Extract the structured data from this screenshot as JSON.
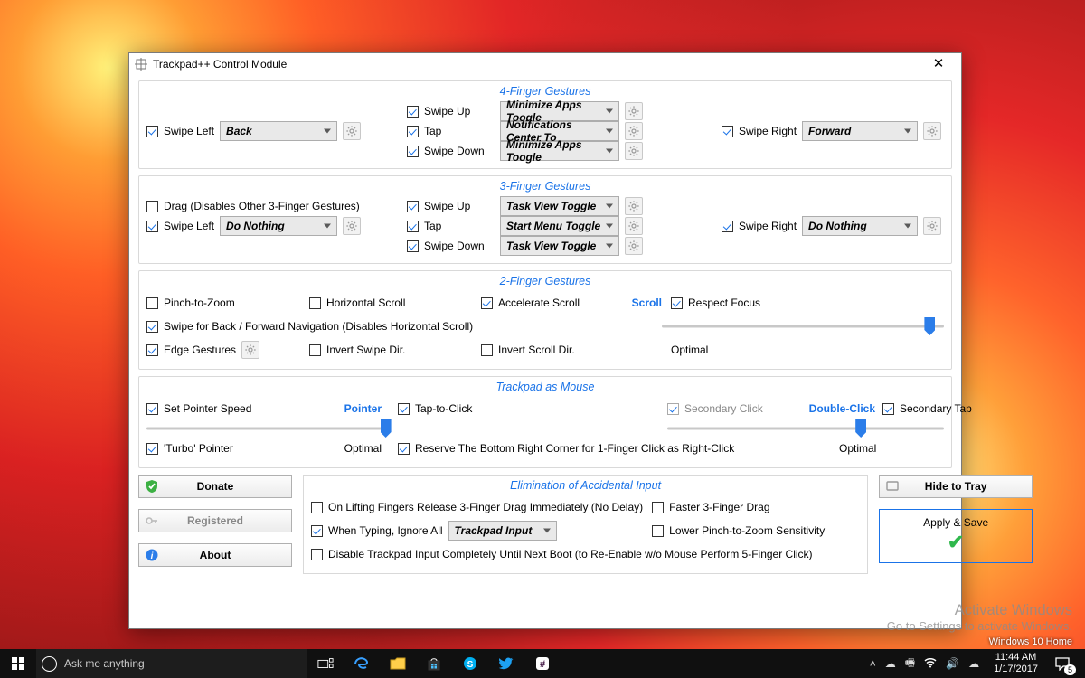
{
  "window": {
    "title": "Trackpad++ Control Module"
  },
  "g4": {
    "title": "4-Finger Gestures",
    "swipe_up": {
      "label": "Swipe Up",
      "value": "Minimize Apps Toogle"
    },
    "tap": {
      "label": "Tap",
      "value": "Notifications Center To"
    },
    "swipe_down": {
      "label": "Swipe Down",
      "value": "Minimize Apps Toogle"
    },
    "swipe_left": {
      "label": "Swipe Left",
      "value": "Back"
    },
    "swipe_right": {
      "label": "Swipe Right",
      "value": "Forward"
    }
  },
  "g3": {
    "title": "3-Finger Gestures",
    "drag": {
      "label": "Drag (Disables Other 3-Finger Gestures)"
    },
    "swipe_up": {
      "label": "Swipe Up",
      "value": "Task View Toggle"
    },
    "tap": {
      "label": "Tap",
      "value": "Start Menu Toggle"
    },
    "swipe_down": {
      "label": "Swipe Down",
      "value": "Task View Toggle"
    },
    "swipe_left": {
      "label": "Swipe Left",
      "value": "Do Nothing"
    },
    "swipe_right": {
      "label": "Swipe Right",
      "value": "Do Nothing"
    }
  },
  "g2": {
    "title": "2-Finger Gestures",
    "pinch": "Pinch-to-Zoom",
    "hscroll": "Horizontal Scroll",
    "accel": "Accelerate Scroll",
    "scroll_link": "Scroll",
    "respect": "Respect Focus",
    "swipe_nav": "Swipe for Back / Forward Navigation (Disables Horizontal Scroll)",
    "edge": "Edge Gestures",
    "invert_swipe": "Invert Swipe Dir.",
    "invert_scroll": "Invert Scroll Dir.",
    "optimal": "Optimal"
  },
  "mouse": {
    "title": "Trackpad as Mouse",
    "set_speed": "Set Pointer Speed",
    "pointer_link": "Pointer",
    "tap_click": "Tap-to-Click",
    "secondary_click": "Secondary Click",
    "double_link": "Double-Click",
    "secondary_tap": "Secondary Tap",
    "turbo": "'Turbo' Pointer",
    "reserve": "Reserve The Bottom Right Corner for 1-Finger Click as Right-Click",
    "optimal": "Optimal"
  },
  "elim": {
    "title": "Elimination of Accidental Input",
    "on_lift": "On Lifting Fingers Release 3-Finger Drag Immediately (No Delay)",
    "faster": "Faster 3-Finger Drag",
    "typing": "When Typing, Ignore All",
    "typing_value": "Trackpad Input",
    "lower_pinch": "Lower Pinch-to-Zoom Sensitivity",
    "disable_full": "Disable Trackpad Input Completely Until Next Boot (to Re-Enable w/o Mouse Perform 5-Finger Click)"
  },
  "buttons": {
    "donate": "Donate",
    "registered": "Registered",
    "about": "About",
    "hide": "Hide to Tray",
    "apply": "Apply & Save"
  },
  "watermark": {
    "line1": "Activate Windows",
    "line2": "Go to Settings to activate Windows."
  },
  "edition": "Windows 10 Home",
  "taskbar": {
    "search_placeholder": "Ask me anything",
    "time": "11:44 AM",
    "date": "1/17/2017",
    "notif_count": "5"
  }
}
